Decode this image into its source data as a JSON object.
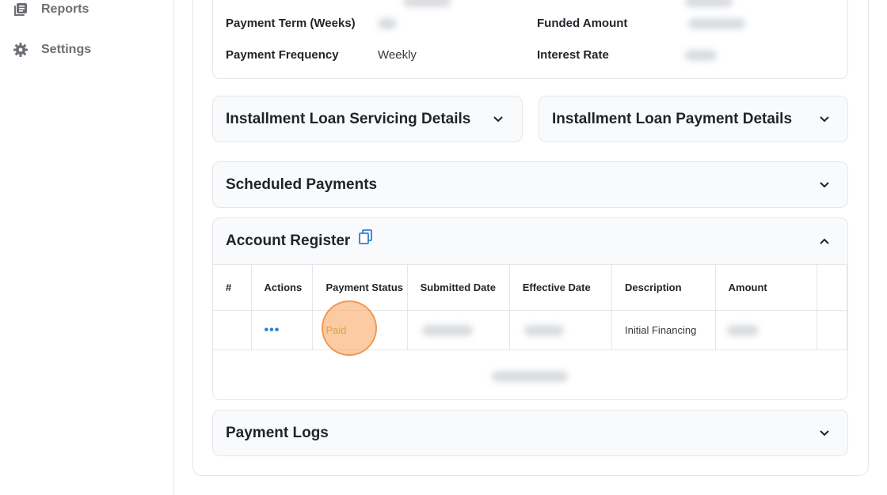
{
  "sidebar": {
    "items": [
      {
        "label": "Reports",
        "icon": "reports-icon"
      },
      {
        "label": "Settings",
        "icon": "gear-icon"
      }
    ]
  },
  "loan_details": {
    "payment_term_label": "Payment Term (Weeks)",
    "payment_frequency_label": "Payment Frequency",
    "payment_frequency_value": "Weekly",
    "funded_amount_label": "Funded Amount",
    "interest_rate_label": "Interest Rate"
  },
  "panels": {
    "servicing_title": "Installment Loan Servicing Details",
    "payment_details_title": "Installment Loan Payment Details",
    "scheduled_title": "Scheduled Payments",
    "register_title": "Account Register",
    "logs_title": "Payment Logs"
  },
  "register": {
    "columns": [
      "#",
      "Actions",
      "Payment Status",
      "Submitted Date",
      "Effective Date",
      "Description",
      "Amount"
    ],
    "rows": [
      {
        "actions": "•••",
        "status": "Paid",
        "description": "Initial Financing"
      }
    ]
  },
  "colors": {
    "accent": "#2f7fd6",
    "paid": "#c9a321",
    "highlight": "#f7a05a"
  }
}
